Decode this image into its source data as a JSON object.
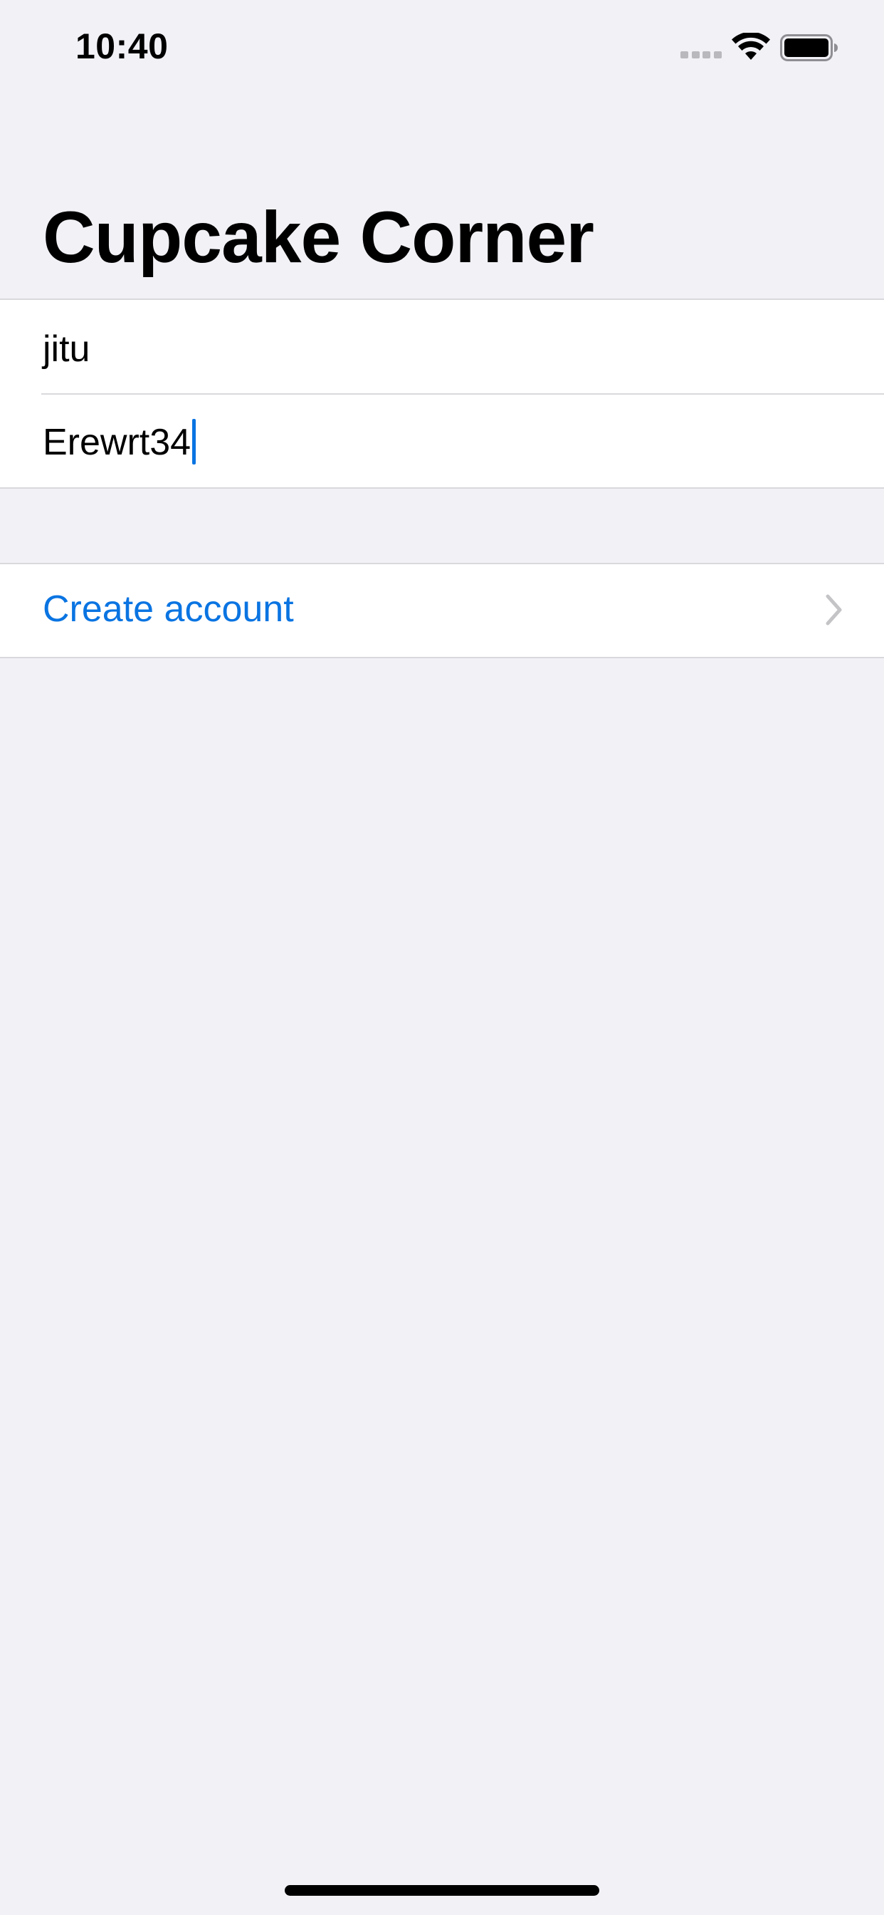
{
  "status_bar": {
    "time": "10:40",
    "signal_icon": "cellular-signal-icon",
    "wifi_icon": "wifi-icon",
    "battery_icon": "battery-icon"
  },
  "navigation": {
    "title": "Cupcake Corner"
  },
  "form": {
    "username_value": "jitu",
    "password_value": "Erewrt34"
  },
  "actions": {
    "create_account_label": "Create account",
    "chevron_icon": "chevron-right-icon"
  },
  "colors": {
    "background": "#f1f1f6",
    "accent": "#0a74e2",
    "separator": "#d9d9dd",
    "chevron": "#c4c4c7"
  }
}
